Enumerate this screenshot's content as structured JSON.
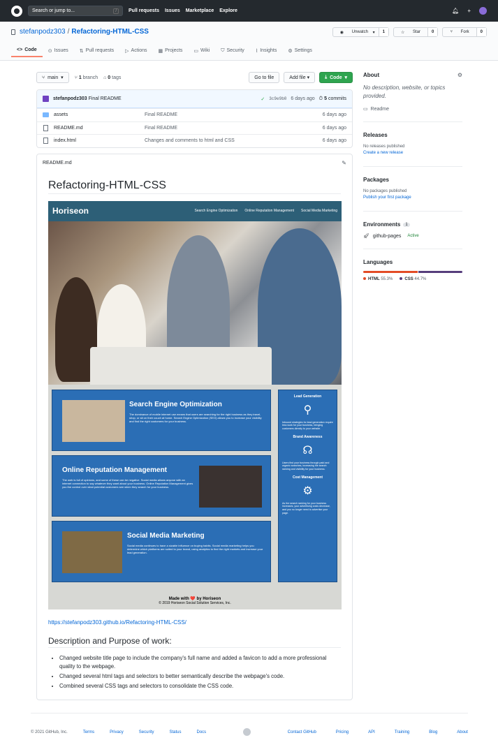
{
  "topbar": {
    "search_placeholder": "Search or jump to...",
    "search_key": "/",
    "nav": [
      "Pull requests",
      "Issues",
      "Marketplace",
      "Explore"
    ],
    "plus": "+"
  },
  "repo": {
    "owner": "stefanpodz303",
    "sep": "/",
    "name": "Refactoring-HTML-CSS",
    "unwatch_label": "Unwatch",
    "unwatch_count": "1",
    "star_label": "Star",
    "star_count": "0",
    "fork_label": "Fork",
    "fork_count": "0",
    "tabs": [
      "Code",
      "Issues",
      "Pull requests",
      "Actions",
      "Projects",
      "Wiki",
      "Security",
      "Insights",
      "Settings"
    ]
  },
  "branchbar": {
    "branch": "main",
    "branches_count": "1",
    "branches_label": "branch",
    "tags_count": "0",
    "tags_label": "tags",
    "goto_file": "Go to file",
    "add_file": "Add file",
    "code": "Code"
  },
  "commit": {
    "author": "stefanpodz303",
    "message": "Final README",
    "check": "✓",
    "sha": "3c9e9b0",
    "age": "6 days ago",
    "count": "5",
    "commits_label": "commits"
  },
  "files": [
    {
      "name": "assets",
      "message": "Final README",
      "age": "6 days ago",
      "type": "folder"
    },
    {
      "name": "README.md",
      "message": "Final README",
      "age": "6 days ago",
      "type": "file"
    },
    {
      "name": "index.html",
      "message": "Changes and comments to html and CSS",
      "age": "6 days ago",
      "type": "file"
    }
  ],
  "readme": {
    "filename": "README.md",
    "title": "Refactoring-HTML-CSS",
    "site": {
      "logo": "Horiseon",
      "nav": [
        "Search Engine Optimization",
        "Online Reputation Management",
        "Social Media Marketing"
      ],
      "cards": [
        {
          "title": "Search Engine Optimization",
          "text": "The dominance of mobile internet use means that users are searching for the right business as they travel, shop, or sit on their couch at home. Search Engine Optimization (SEO) allows you to increase your visibility and find the right customers for your business."
        },
        {
          "title": "Online Reputation Management",
          "text": "The web is full of opinions, and some of these can be negative. Social media allows anyone with an internet connection to say whatever they want about your business. Online Reputation Management gives you the control over what potential customers see when they search for your business."
        },
        {
          "title": "Social Media Marketing",
          "text": "Social media continues to have a sizable influence on buying habits. Social media marketing helps you determine which platforms are suited to your brand, using analytics to find the right markets and increase your lead generation."
        }
      ],
      "benefits": [
        {
          "title": "Lead Generation",
          "text": "Inbound strategies for lead generation require less work for your business, bringing customers directly to your website."
        },
        {
          "title": "Brand Awareness",
          "text": "Users find your business through paid and organic searches, increasing the search ranking and visibility for your business."
        },
        {
          "title": "Cost Management",
          "text": "As the search ranking for your business increases, your advertising costs decrease, and you no longer need to advertise your page."
        }
      ],
      "footer_made": "Made with ❤️ by Horiseon",
      "footer_copy": "© 2019 Horiseon Social Solution Services, Inc."
    },
    "link": "https://stefanpodz303.github.io/Refactoring-HTML-CSS/",
    "section_title": "Description and Purpose of work:",
    "bullets": [
      "Changed website title page to include the company's full name and added a favicon to add a more professional quality to the webpage.",
      "Changed several html tags and selectors to better semantically describe the webpage's code.",
      "Combined several CSS tags and selectors to consolidate the CSS code."
    ]
  },
  "sidebar": {
    "about_title": "About",
    "about_desc": "No description, website, or topics provided.",
    "readme_label": "Readme",
    "releases_title": "Releases",
    "releases_none": "No releases published",
    "releases_link": "Create a new release",
    "packages_title": "Packages",
    "packages_none": "No packages published",
    "packages_link": "Publish your first package",
    "env_title": "Environments",
    "env_count": "1",
    "env_name": "github-pages",
    "env_status": "Active",
    "lang_title": "Languages",
    "languages": [
      {
        "name": "HTML",
        "percent": "55.3%",
        "color": "#e34c26",
        "value": 55.3
      },
      {
        "name": "CSS",
        "percent": "44.7%",
        "color": "#563d7c",
        "value": 44.7
      }
    ]
  },
  "footer": {
    "copyright": "© 2021 GitHub, Inc.",
    "left_links": [
      "Terms",
      "Privacy",
      "Security",
      "Status",
      "Docs"
    ],
    "right_links": [
      "Contact GitHub",
      "Pricing",
      "API",
      "Training",
      "Blog",
      "About"
    ]
  }
}
